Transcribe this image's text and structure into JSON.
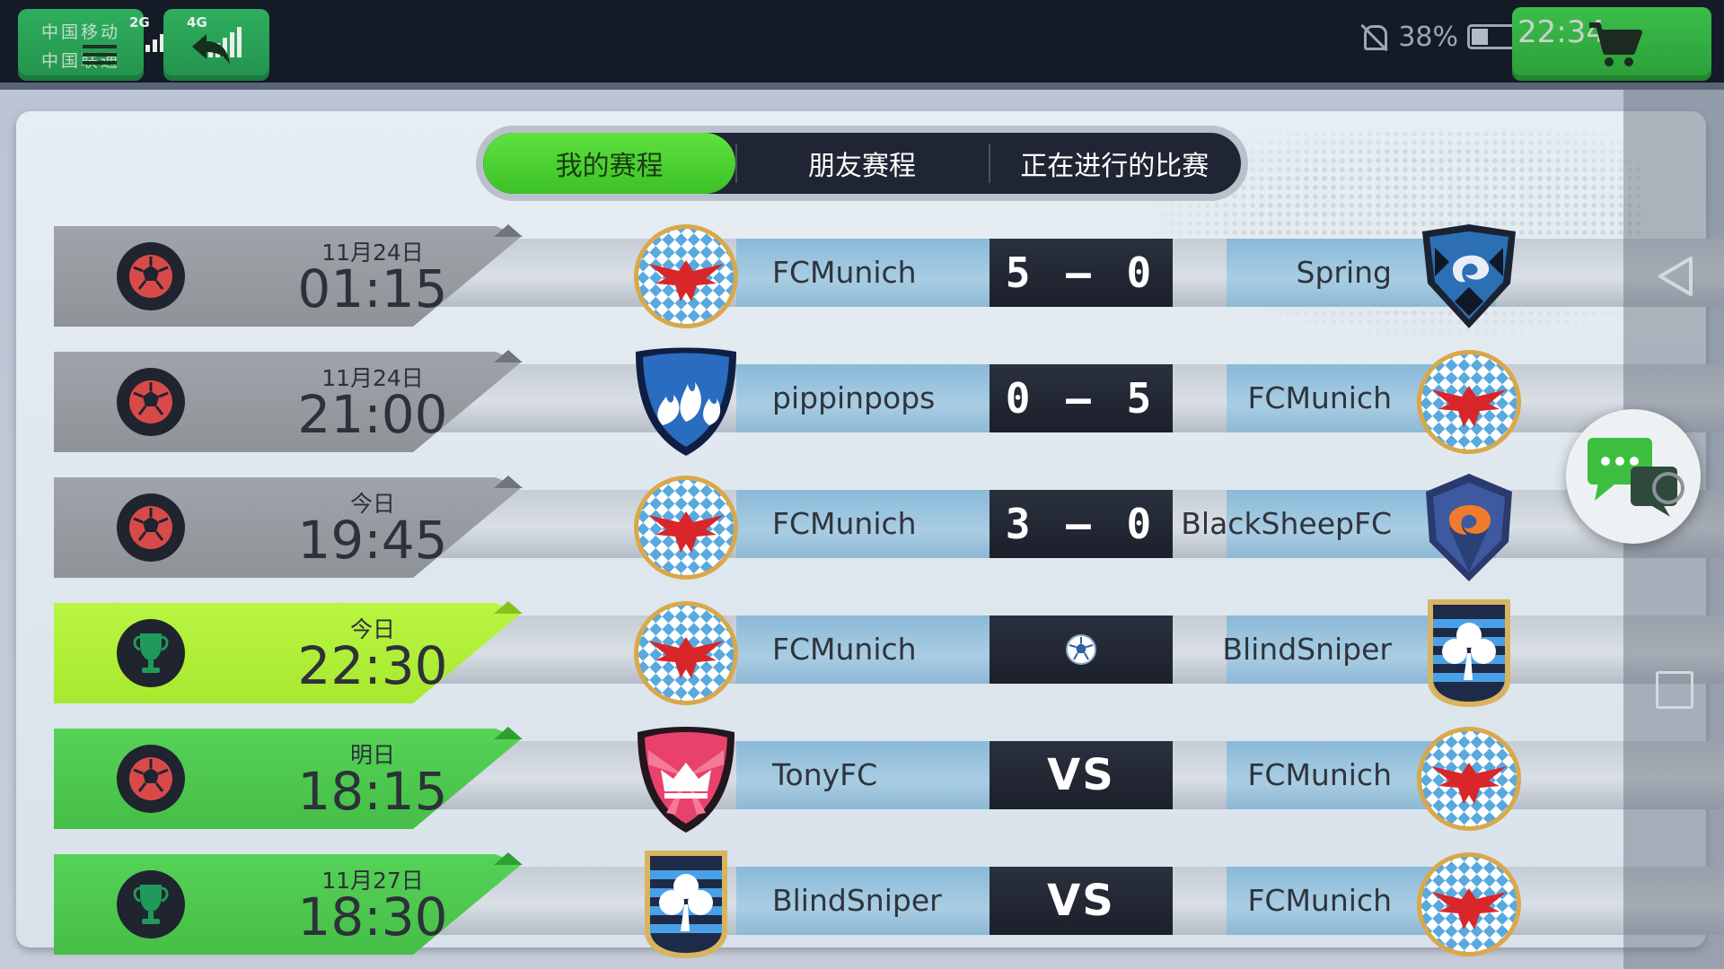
{
  "status_bar": {
    "carrier_line1": "中国移动",
    "carrier_line2": "中国联通",
    "signal1_label": "2G",
    "signal2_label": "4G",
    "battery_percent": "38%",
    "battery_level": 0.38,
    "time": "22:34"
  },
  "tabs": [
    {
      "label": "我的赛程",
      "active": true
    },
    {
      "label": "朋友赛程",
      "active": false
    },
    {
      "label": "正在进行的比赛",
      "active": false
    }
  ],
  "matches": [
    {
      "state": "past",
      "competition_icon": "league-ball-icon",
      "date": "11月24日",
      "time": "01:15",
      "home": "FCMunich",
      "home_crest": "eagle-crest",
      "score": "5 — 0",
      "away": "Spring",
      "away_crest": "dragon-crest"
    },
    {
      "state": "past",
      "competition_icon": "league-ball-icon",
      "date": "11月24日",
      "time": "21:00",
      "home": "pippinpops",
      "home_crest": "flame-shield-crest",
      "score": "0 — 5",
      "away": "FCMunich",
      "away_crest": "eagle-crest"
    },
    {
      "state": "past",
      "competition_icon": "league-ball-icon",
      "date": "今日",
      "time": "19:45",
      "home": "FCMunich",
      "home_crest": "eagle-crest",
      "score": "3 — 0",
      "away": "BlackSheepFC",
      "away_crest": "orange-dragon-crest"
    },
    {
      "state": "live",
      "competition_icon": "trophy-icon",
      "date": "今日",
      "time": "22:30",
      "home": "FCMunich",
      "home_crest": "eagle-crest",
      "score": "",
      "away": "BlindSniper",
      "away_crest": "clover-crest"
    },
    {
      "state": "future",
      "competition_icon": "league-ball-icon",
      "date": "明日",
      "time": "18:15",
      "home": "TonyFC",
      "home_crest": "crown-shield-crest",
      "score": "VS",
      "away": "FCMunich",
      "away_crest": "eagle-crest"
    },
    {
      "state": "future",
      "competition_icon": "trophy-icon",
      "date": "11月27日",
      "time": "18:30",
      "home": "BlindSniper",
      "home_crest": "clover-crest",
      "score": "VS",
      "away": "FCMunich",
      "away_crest": "eagle-crest"
    }
  ],
  "colors": {
    "tab_active": "#4fd532",
    "past_row": "#979ca1",
    "live_row": "#b0ee38",
    "future_row": "#4ec84f",
    "team_stripe": "#9cc4de",
    "score_box": "#222834"
  }
}
